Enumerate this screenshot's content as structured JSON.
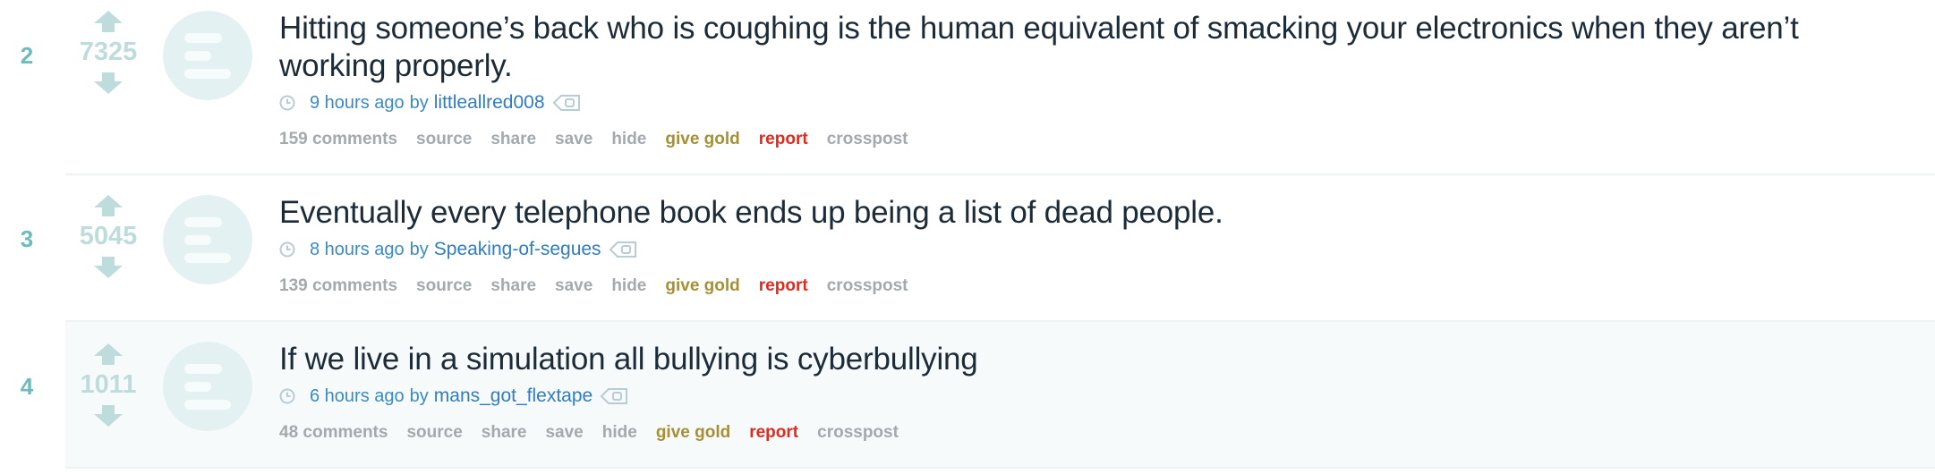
{
  "posts": [
    {
      "rank": "2",
      "score": "7325",
      "title": "Hitting someone’s back who is coughing is the human equivalent of smacking your electronics when they aren’t working properly.",
      "time": "9 hours ago",
      "by": "by",
      "author": "littleallred008",
      "actions": {
        "comments": "159 comments",
        "source": "source",
        "share": "share",
        "save": "save",
        "hide": "hide",
        "give_gold": "give gold",
        "report": "report",
        "crosspost": "crosspost"
      }
    },
    {
      "rank": "3",
      "score": "5045",
      "title": "Eventually every telephone book ends up being a list of dead people.",
      "time": "8 hours ago",
      "by": "by",
      "author": "Speaking-of-segues",
      "actions": {
        "comments": "139 comments",
        "source": "source",
        "share": "share",
        "save": "save",
        "hide": "hide",
        "give_gold": "give gold",
        "report": "report",
        "crosspost": "crosspost"
      }
    },
    {
      "rank": "4",
      "score": "1011",
      "title": "If we live in a simulation all bullying is cyberbullying",
      "time": "6 hours ago",
      "by": "by",
      "author": "mans_got_flextape",
      "actions": {
        "comments": "48 comments",
        "source": "source",
        "share": "share",
        "save": "save",
        "hide": "hide",
        "give_gold": "give gold",
        "report": "report",
        "crosspost": "crosspost"
      }
    }
  ],
  "icons": {
    "upvote": "upvote-arrow-icon",
    "downvote": "downvote-arrow-icon",
    "thumbnail": "self-post-thumbnail-icon",
    "clock": "clock-icon",
    "flair": "user-flair-tag-icon"
  },
  "colors": {
    "rank": "#6cbcbd",
    "score": "#bfdcdc",
    "title": "#1c2b38",
    "link": "#2f7cc2",
    "action": "#a3a9ad",
    "gold": "#a59038",
    "report": "#dd2c1f"
  }
}
